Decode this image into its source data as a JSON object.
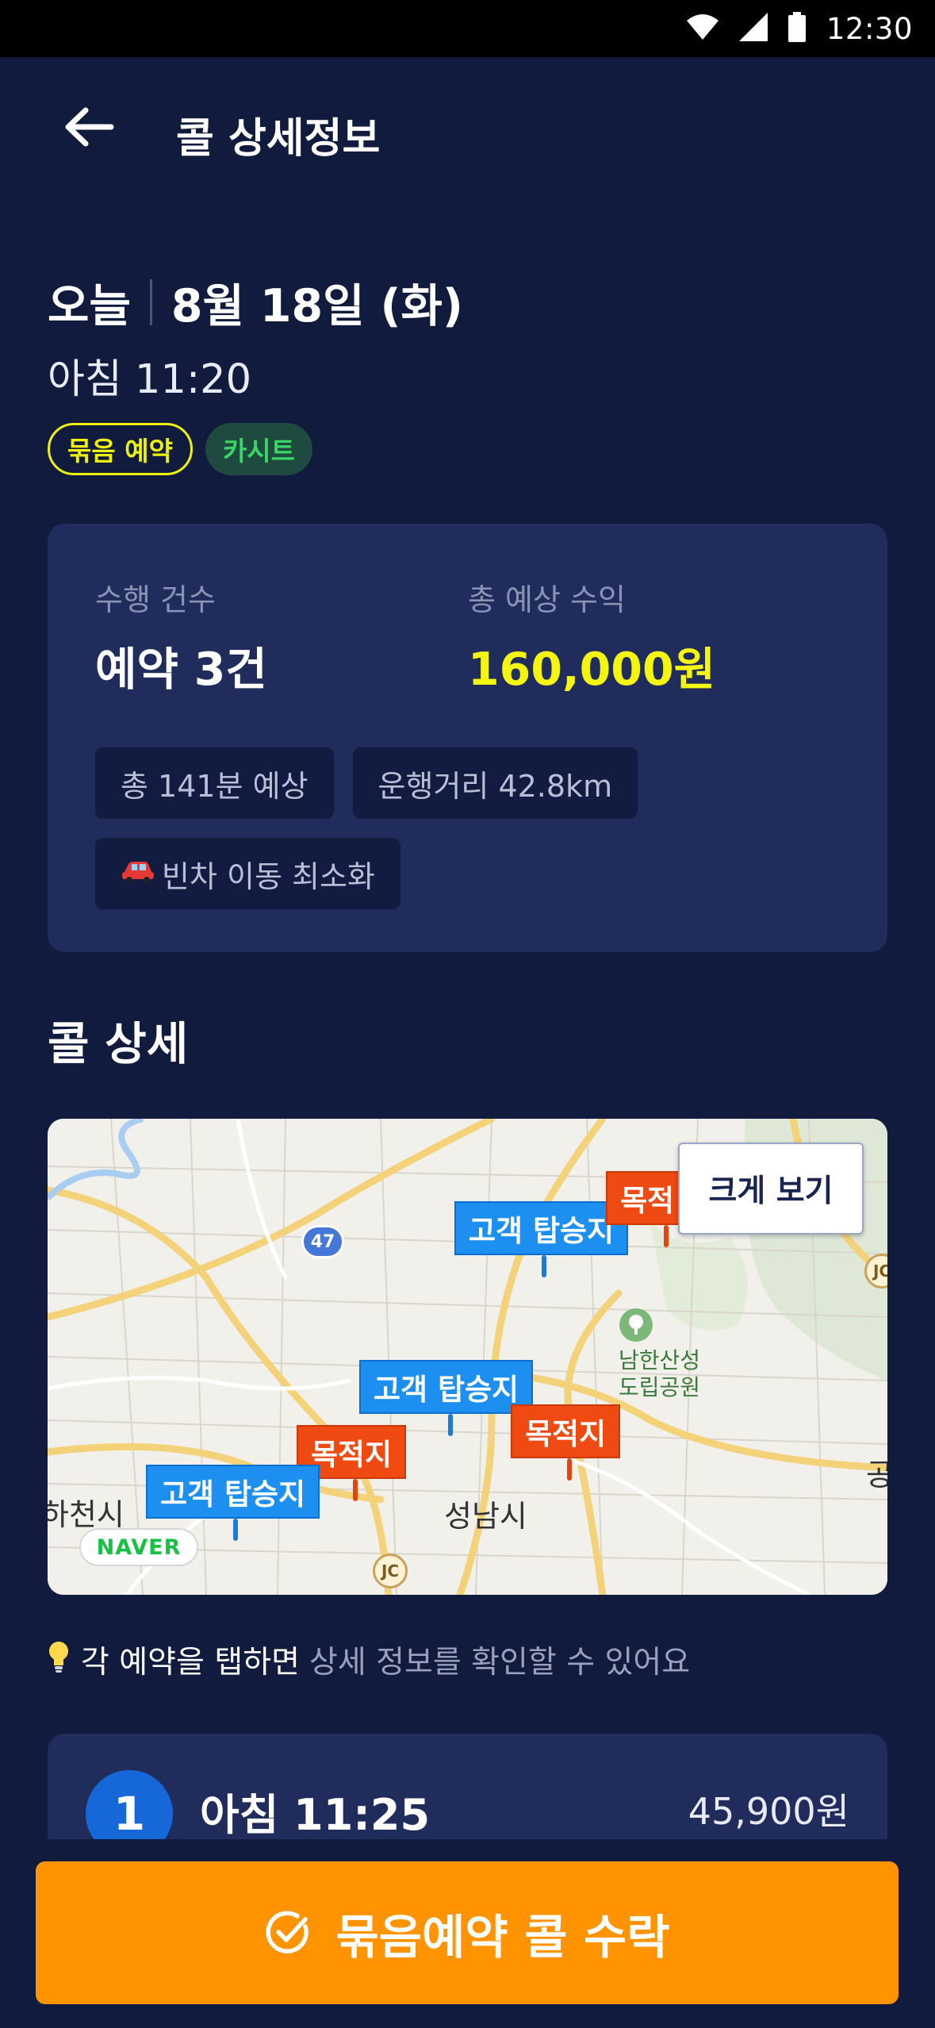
{
  "status_bar": {
    "time": "12:30"
  },
  "header": {
    "title": "콜 상세정보"
  },
  "schedule": {
    "day_label": "오늘",
    "date": "8월 18일 (화)",
    "time": "아침 11:20",
    "tags": [
      "묶음 예약",
      "카시트"
    ]
  },
  "summary": {
    "count_label": "수행 건수",
    "count_value": "예약 3건",
    "revenue_label": "총 예상 수익",
    "revenue_value": "160,000원",
    "chips": [
      "총 141분 예상",
      "운행거리 42.8km",
      "빈차 이동 최소화"
    ]
  },
  "details": {
    "title": "콜 상세",
    "map": {
      "enlarge_label": "크게 보기",
      "pickup_label": "고객 탑승지",
      "destination_label": "목적지",
      "destination_label_cut": "목적",
      "city_label": "성남시",
      "city_left_label": "하천시",
      "park_label_line1": "남한산성",
      "park_label_line2": "도립공원",
      "edge_label": "공",
      "road_number": "47",
      "jc_label": "JC",
      "provider": "NAVER"
    },
    "tip_main": "각 예약을 탭하면",
    "tip_sub": "상세 정보를 확인할 수 있어요"
  },
  "reservations": [
    {
      "number": "1",
      "time": "아침 11:25",
      "price": "45,900원"
    }
  ],
  "action": {
    "accept_label": "묶음예약 콜 수락"
  },
  "colors": {
    "background": "#111b3d",
    "card": "#1f2c5c",
    "accent_yellow": "#f4f60f",
    "accent_orange": "#ff9400"
  },
  "icons": [
    "wifi-icon",
    "signal-icon",
    "battery-icon",
    "back-arrow-icon",
    "car-icon",
    "bulb-icon",
    "check-circle-icon"
  ]
}
